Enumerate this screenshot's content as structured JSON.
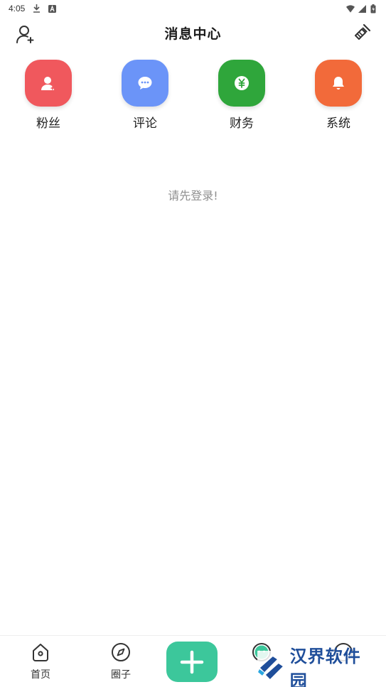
{
  "status_bar": {
    "time": "4:05",
    "icons": [
      "download-icon",
      "a-icon",
      "wifi-icon",
      "signal-icon",
      "battery-icon"
    ]
  },
  "header": {
    "title": "消息中心",
    "left_icon": "add-user-icon",
    "right_icon": "broom-icon"
  },
  "categories": [
    {
      "label": "粉丝",
      "icon": "fans-icon",
      "color": "#f0585d"
    },
    {
      "label": "评论",
      "icon": "comment-icon",
      "color": "#6b94f8"
    },
    {
      "label": "财务",
      "icon": "finance-icon",
      "color": "#2fa63b"
    },
    {
      "label": "系统",
      "icon": "bell-icon",
      "color": "#f26a3a"
    }
  ],
  "empty_message": "请先登录!",
  "bottom_nav": {
    "items": [
      {
        "label": "首页",
        "icon": "home-icon"
      },
      {
        "label": "圈子",
        "icon": "compass-icon"
      },
      {
        "label": "",
        "icon": "add-icon",
        "color": "#3cc79b"
      },
      {
        "label": "",
        "icon": "message-icon"
      },
      {
        "label": "",
        "icon": "user-icon"
      }
    ]
  },
  "watermark": {
    "text": "汉界软件园"
  }
}
